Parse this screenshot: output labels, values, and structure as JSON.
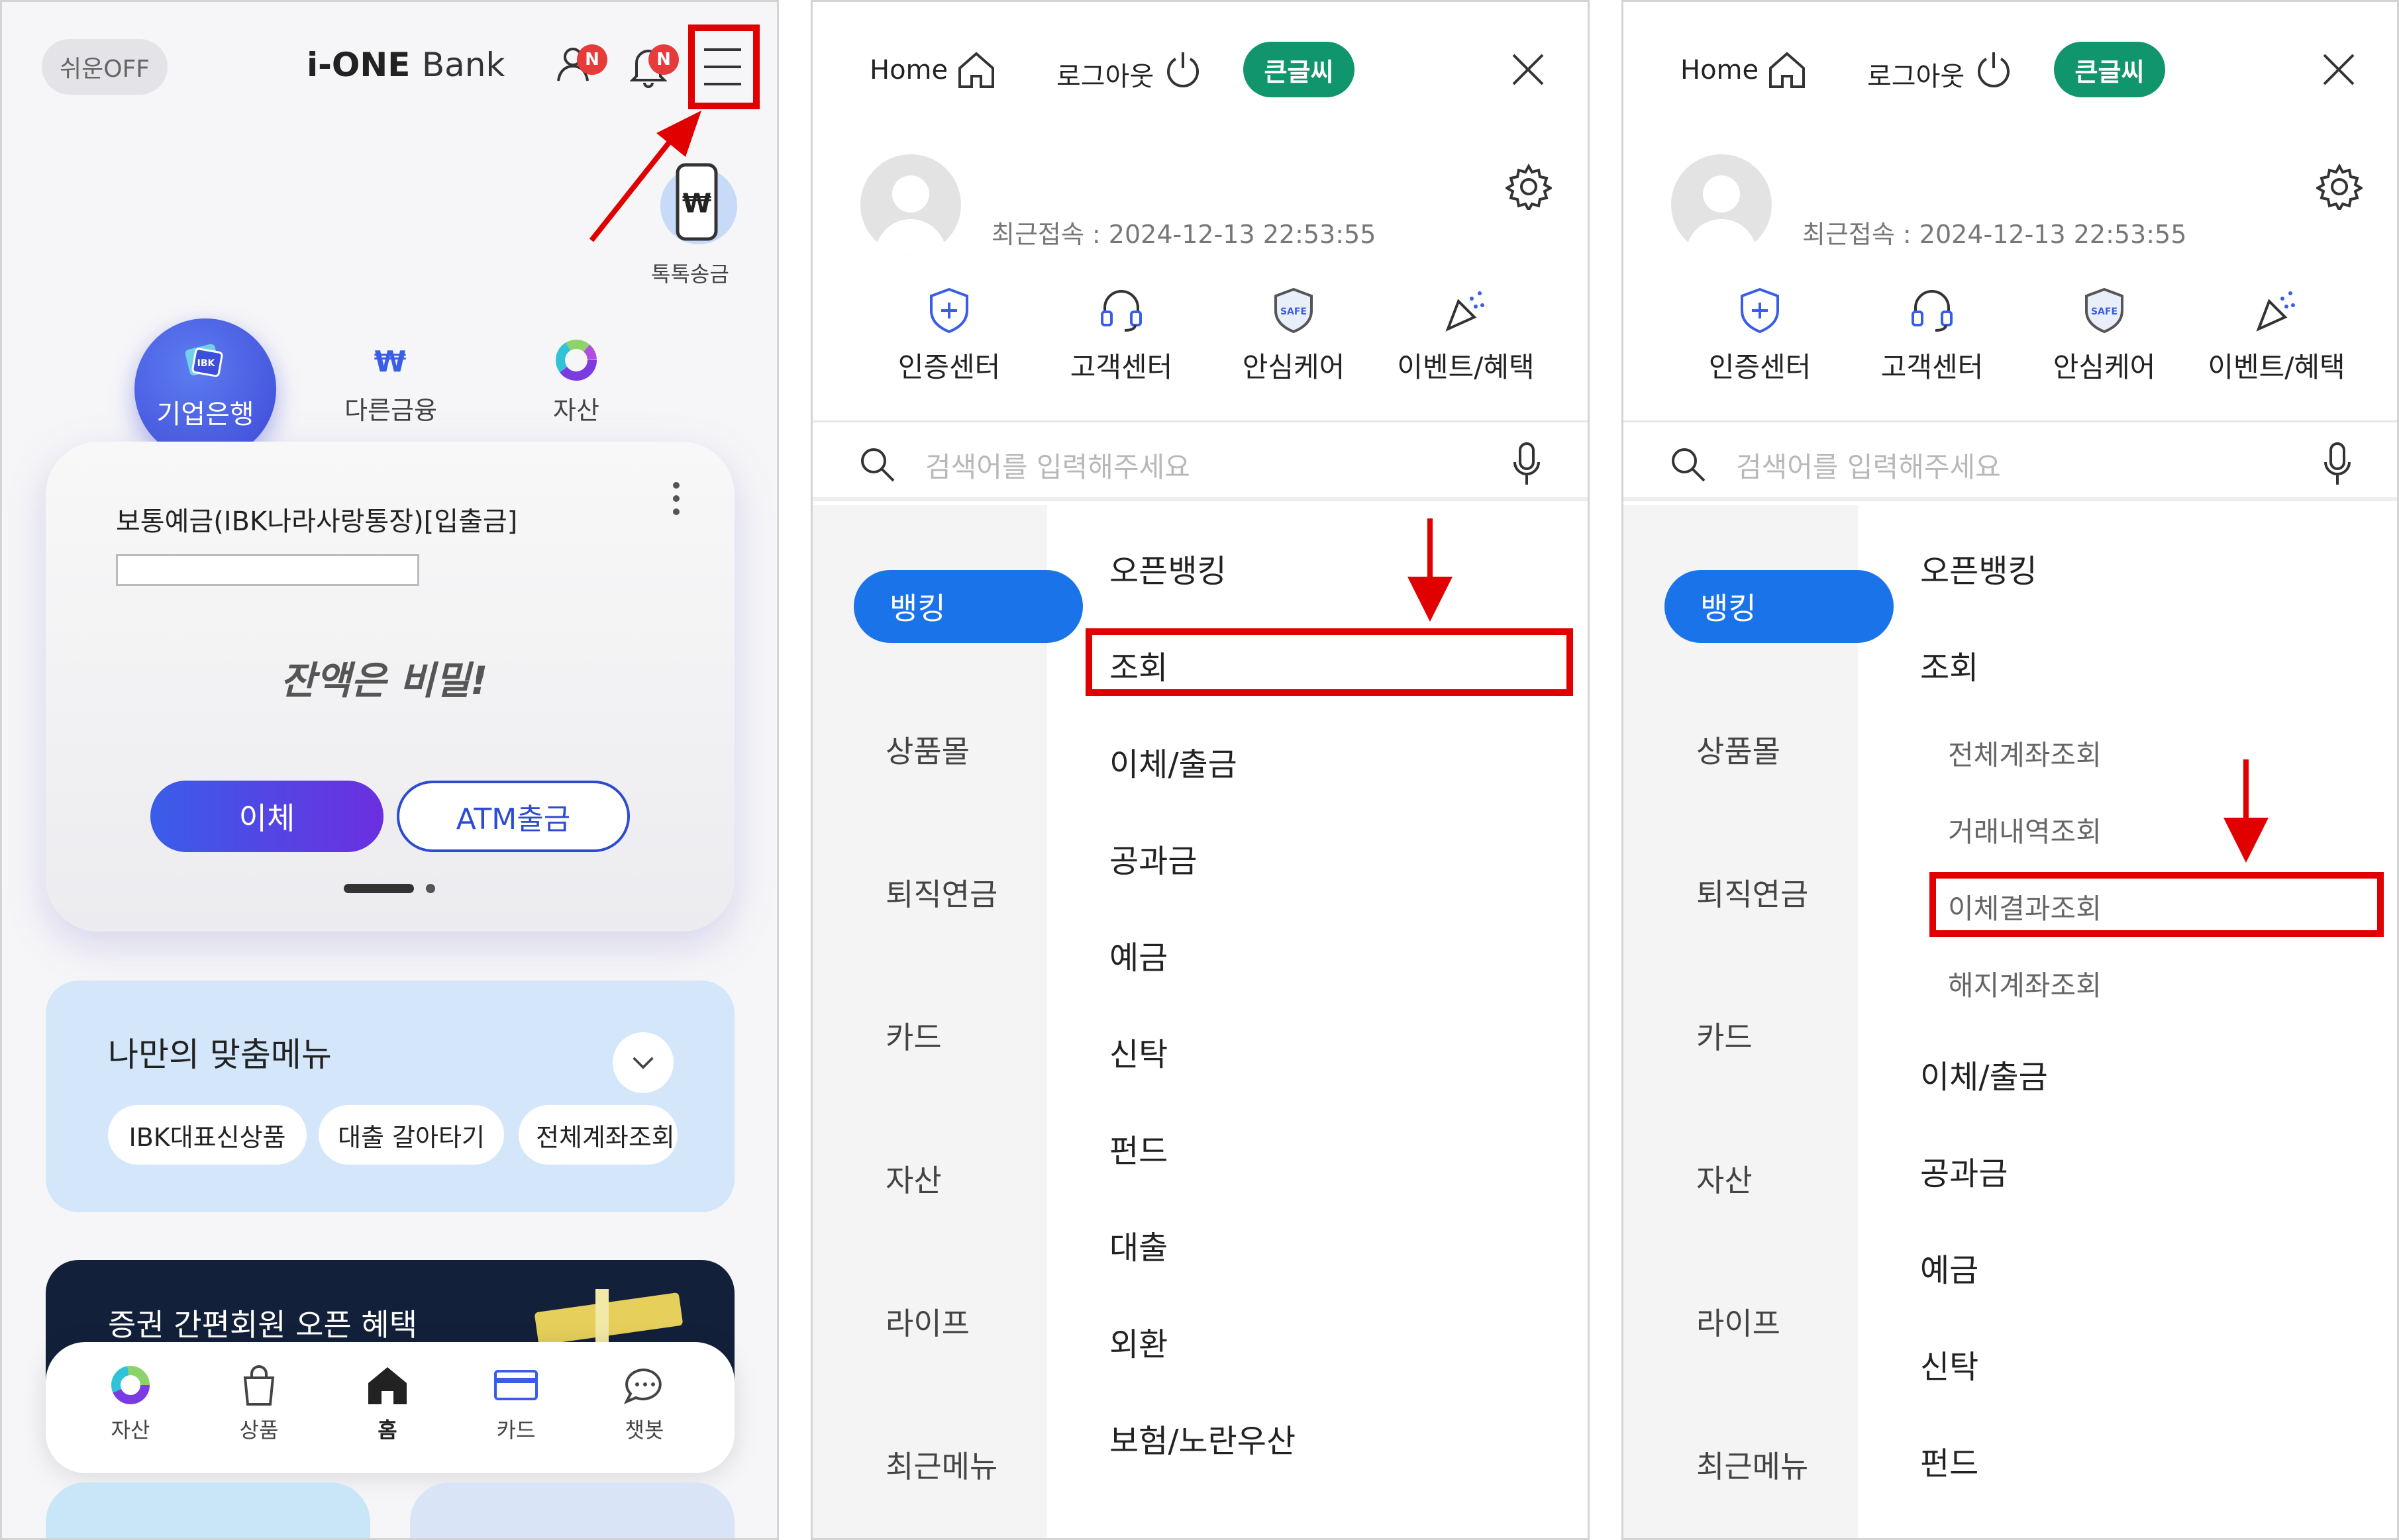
{
  "screen1": {
    "easy_toggle": "쉬운OFF",
    "logo_main": "i-ONE",
    "logo_sub": "Bank",
    "profile_badge": "N",
    "bell_badge": "N",
    "quick_send": "톡톡송금",
    "tabs": [
      "기업은행",
      "다른금융",
      "자산"
    ],
    "account_name": "보통예금(IBK나라사랑통장)[입출금]",
    "balance_secret": "잔액은 비밀!",
    "transfer_button": "이체",
    "atm_button": "ATM출금",
    "my_menu_title": "나만의 맞춤메뉴",
    "my_menu_chips": [
      "IBK대표신상품",
      "대출 갈아타기",
      "전체계좌조회"
    ],
    "promo_text": "증권 간편회원 오픈 혜택",
    "bottom_nav": [
      "자산",
      "상품",
      "홈",
      "카드",
      "챗봇"
    ]
  },
  "menu": {
    "home": "Home",
    "logout": "로그아웃",
    "big_font": "큰글씨",
    "last_login": "최근접속 : 2024-12-13 22:53:55",
    "quick_links": [
      "인증센터",
      "고객센터",
      "안심케어",
      "이벤트/혜택"
    ],
    "search_placeholder": "검색어를 입력해주세요",
    "categories": [
      "뱅킹",
      "상품몰",
      "퇴직연금",
      "카드",
      "자산",
      "라이프",
      "최근메뉴"
    ],
    "screen2_items": [
      "오픈뱅킹",
      "조회",
      "이체/출금",
      "공과금",
      "예금",
      "신탁",
      "펀드",
      "대출",
      "외환",
      "보험/노란우산"
    ],
    "screen3_items": [
      "오픈뱅킹",
      "조회",
      "이체/출금",
      "공과금",
      "예금",
      "신탁",
      "펀드"
    ],
    "screen3_subitems": [
      "전체계좌조회",
      "거래내역조회",
      "이체결과조회",
      "해지계좌조회"
    ]
  },
  "colors": {
    "highlight_red": "#e00000",
    "brand_blue": "#1a73e8",
    "big_font_green": "#11956c"
  }
}
